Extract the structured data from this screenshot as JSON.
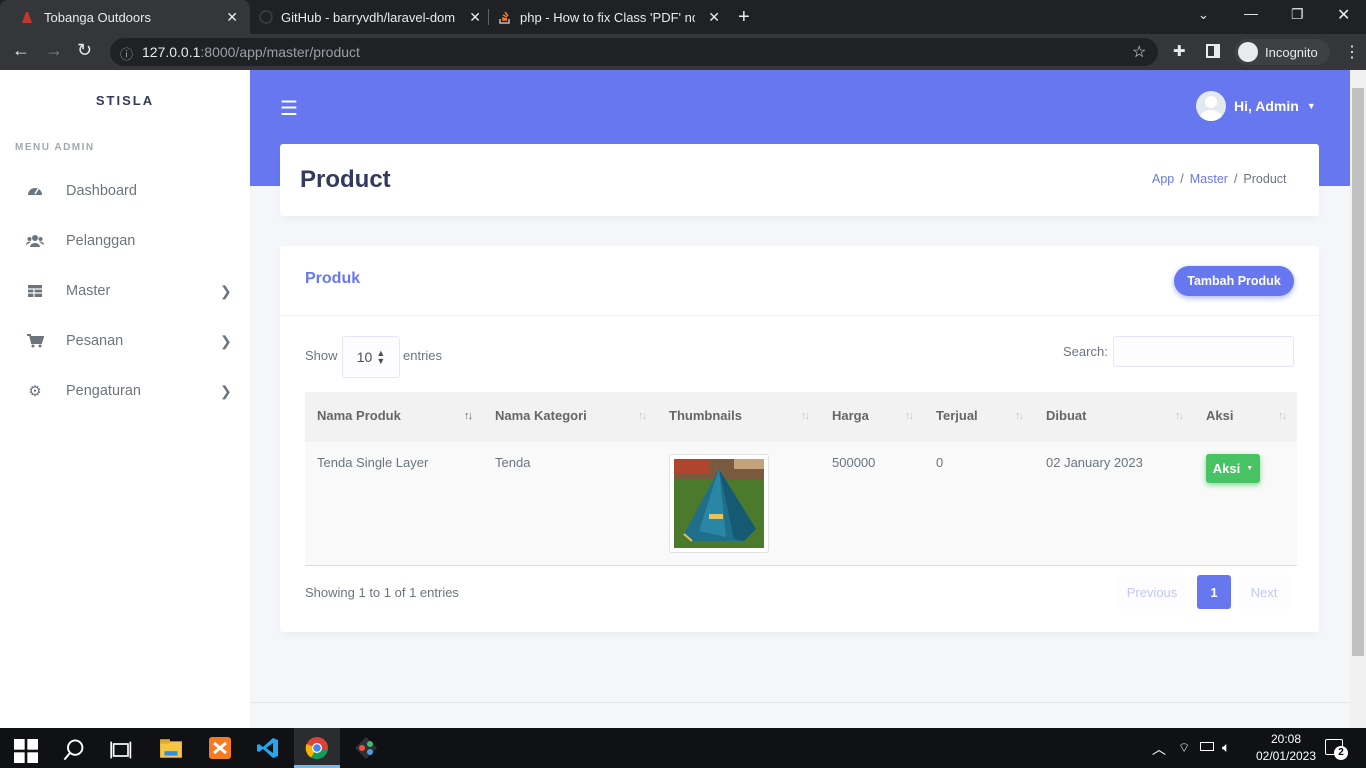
{
  "browser": {
    "tabs": [
      {
        "title": "Tobanga Outdoors"
      },
      {
        "title": "GitHub - barryvdh/laravel-dompdf"
      },
      {
        "title": "php - How to fix Class 'PDF' not found"
      }
    ],
    "url_host": "127.0.0.1",
    "url_path": ":8000/app/master/product",
    "profile": "Incognito"
  },
  "sidebar": {
    "brand": "STISLA",
    "menu_header": "MENU ADMIN",
    "items": [
      {
        "label": "Dashboard",
        "icon": "dashboard-icon"
      },
      {
        "label": "Pelanggan",
        "icon": "users-icon"
      },
      {
        "label": "Master",
        "icon": "table-icon"
      },
      {
        "label": "Pesanan",
        "icon": "cart-icon"
      },
      {
        "label": "Pengaturan",
        "icon": "gear-icon"
      }
    ]
  },
  "header": {
    "user_greeting": "Hi, Admin",
    "page_title": "Product",
    "breadcrumb": [
      "App",
      "Master",
      "Product"
    ]
  },
  "card": {
    "title": "Produk",
    "add_button": "Tambah Produk",
    "show_label": "Show",
    "page_length": "10",
    "entries_label": "entries",
    "search_label": "Search:",
    "columns": [
      "Nama Produk",
      "Nama Kategori",
      "Thumbnails",
      "Harga",
      "Terjual",
      "Dibuat",
      "Aksi"
    ],
    "rows": [
      {
        "nama_produk": "Tenda Single Layer",
        "nama_kategori": "Tenda",
        "harga": "500000",
        "terjual": "0",
        "dibuat": "02 January 2023",
        "aksi": "Aksi"
      }
    ],
    "info": "Showing 1 to 1 of 1 entries",
    "pagination": {
      "previous": "Previous",
      "current": "1",
      "next": "Next"
    }
  },
  "taskbar": {
    "time": "20:08",
    "date": "02/01/2023",
    "notification_count": "2"
  }
}
